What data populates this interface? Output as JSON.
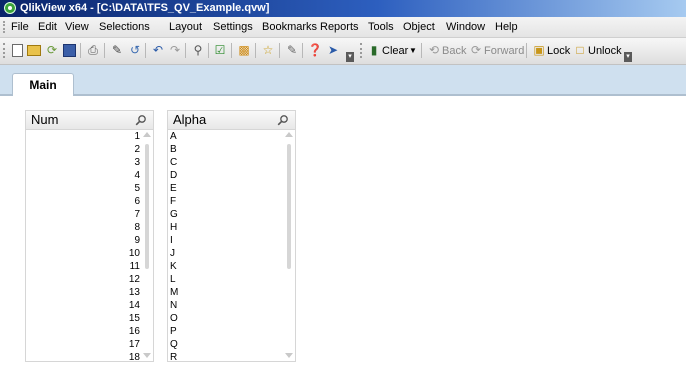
{
  "window": {
    "title": "QlikView x64 - [C:\\DATA\\TFS_QV_Example.qvw]"
  },
  "menu": [
    "File",
    "Edit",
    "View",
    "Selections",
    "Layout",
    "Settings",
    "Bookmarks",
    "Reports",
    "Tools",
    "Object",
    "Window",
    "Help"
  ],
  "toolbar": {
    "clear_label": "Clear",
    "back_label": "Back",
    "forward_label": "Forward",
    "lock_label": "Lock",
    "unlock_label": "Unlock"
  },
  "tabs": [
    {
      "label": "Main"
    }
  ],
  "listboxes": [
    {
      "title": "Num",
      "values": [
        "1",
        "2",
        "3",
        "4",
        "5",
        "6",
        "7",
        "8",
        "9",
        "10",
        "11",
        "12",
        "13",
        "14",
        "15",
        "16",
        "17",
        "18"
      ]
    },
    {
      "title": "Alpha",
      "values": [
        "A",
        "B",
        "C",
        "D",
        "E",
        "F",
        "G",
        "H",
        "I",
        "J",
        "K",
        "L",
        "M",
        "N",
        "O",
        "P",
        "Q",
        "R"
      ]
    }
  ],
  "colors": {
    "titlebar": "#0a246a",
    "tabbar": "#cfe0ef",
    "scrollbar": "#d6d6d6"
  }
}
